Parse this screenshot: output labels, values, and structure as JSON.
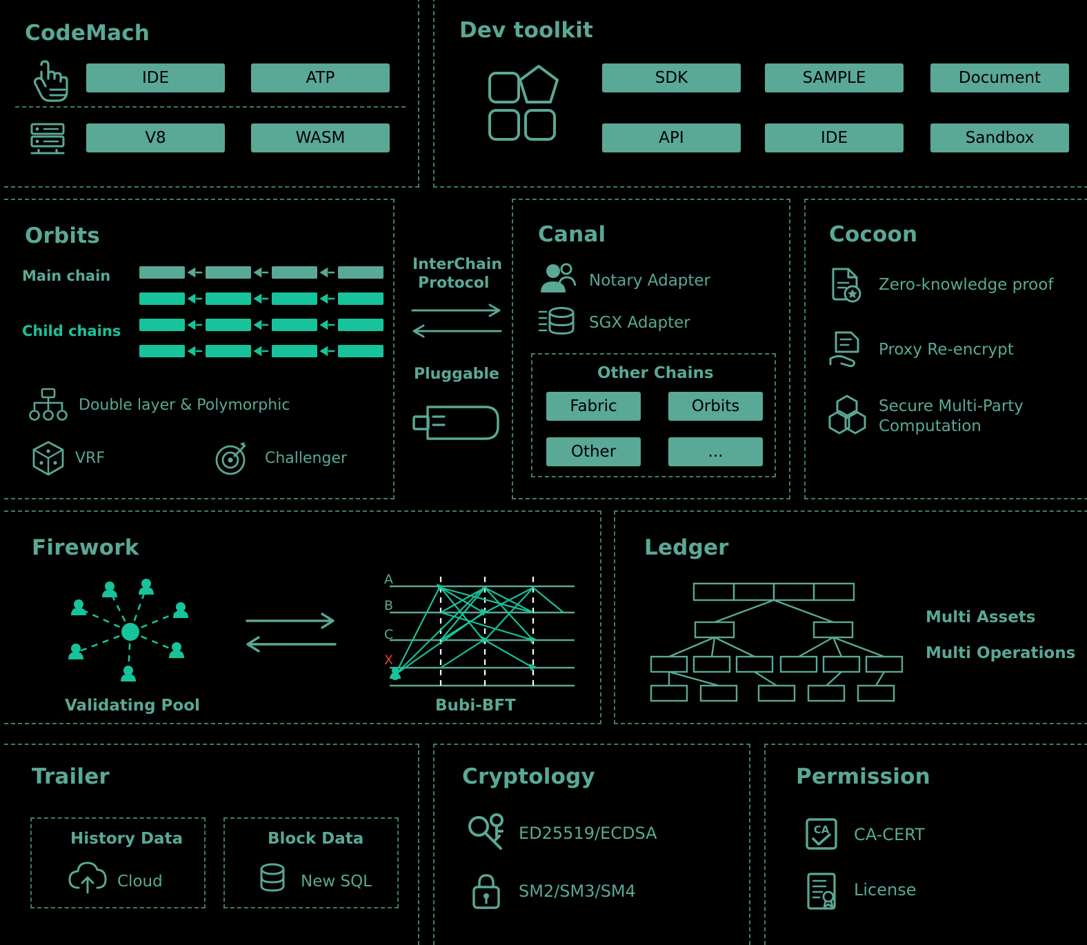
{
  "theme": {
    "background": "#000000",
    "accent": "#5aa896",
    "accent_bright": "#17c39a",
    "border": "#3f7c6e",
    "pill_text": "#000000",
    "alert": "#e2452b"
  },
  "panels": {
    "codemach": {
      "title": "CodeMach",
      "icons": [
        "hand-click-icon",
        "server-icon"
      ],
      "pills": [
        "IDE",
        "ATP",
        "V8",
        "WASM"
      ]
    },
    "dev_toolkit": {
      "title": "Dev toolkit",
      "icon": "modules-icon",
      "pills": [
        "SDK",
        "SAMPLE",
        "Document",
        "API",
        "IDE",
        "Sandbox"
      ]
    },
    "orbits": {
      "title": "Orbits",
      "main_chain_label": "Main chain",
      "child_chains_label": "Child chains",
      "features": [
        {
          "icon": "hierarchy-icon",
          "label": "Double layer & Polymorphic"
        },
        {
          "icon": "dice-icon",
          "label": "VRF"
        },
        {
          "icon": "target-icon",
          "label": "Challenger"
        }
      ]
    },
    "interchain": {
      "protocol_label_line1": "InterChain",
      "protocol_label_line2": "Protocol",
      "pluggable_label": "Pluggable",
      "pluggable_icon": "usb-plug-icon"
    },
    "canal": {
      "title": "Canal",
      "adapters": [
        {
          "icon": "notary-person-icon",
          "label": "Notary Adapter"
        },
        {
          "icon": "sgx-chip-icon",
          "label": "SGX Adapter"
        }
      ],
      "other_chains_title": "Other Chains",
      "other_chains": [
        "Fabric",
        "Orbits",
        "Other",
        "..."
      ]
    },
    "cocoon": {
      "title": "Cocoon",
      "items": [
        {
          "icon": "zk-document-icon",
          "label": "Zero-knowledge proof"
        },
        {
          "icon": "proxy-hand-doc-icon",
          "label": "Proxy Re-encrypt"
        },
        {
          "icon": "hexagons-icon",
          "label": "Secure Multi-Party\nComputation",
          "line1": "Secure Multi-Party",
          "line2": "Computation"
        }
      ]
    },
    "firework": {
      "title": "Firework",
      "pool_label": "Validating Pool",
      "bft_label": "Bubi-BFT",
      "bft_rows": [
        "A",
        "B",
        "C",
        "X"
      ]
    },
    "ledger": {
      "title": "Ledger",
      "labels": [
        "Multi Assets",
        "Multi Operations"
      ]
    },
    "trailer": {
      "title": "Trailer",
      "groups": [
        {
          "title": "History Data",
          "icon": "cloud-upload-icon",
          "label": "Cloud"
        },
        {
          "title": "Block Data",
          "icon": "database-icon",
          "label": "New SQL"
        }
      ]
    },
    "cryptology": {
      "title": "Cryptology",
      "items": [
        {
          "icon": "key-icon",
          "label": "ED25519/ECDSA"
        },
        {
          "icon": "lock-icon",
          "label": "SM2/SM3/SM4"
        }
      ]
    },
    "permission": {
      "title": "Permission",
      "items": [
        {
          "icon": "ca-cert-icon",
          "label": "CA-CERT"
        },
        {
          "icon": "license-doc-icon",
          "label": "License"
        }
      ]
    }
  }
}
